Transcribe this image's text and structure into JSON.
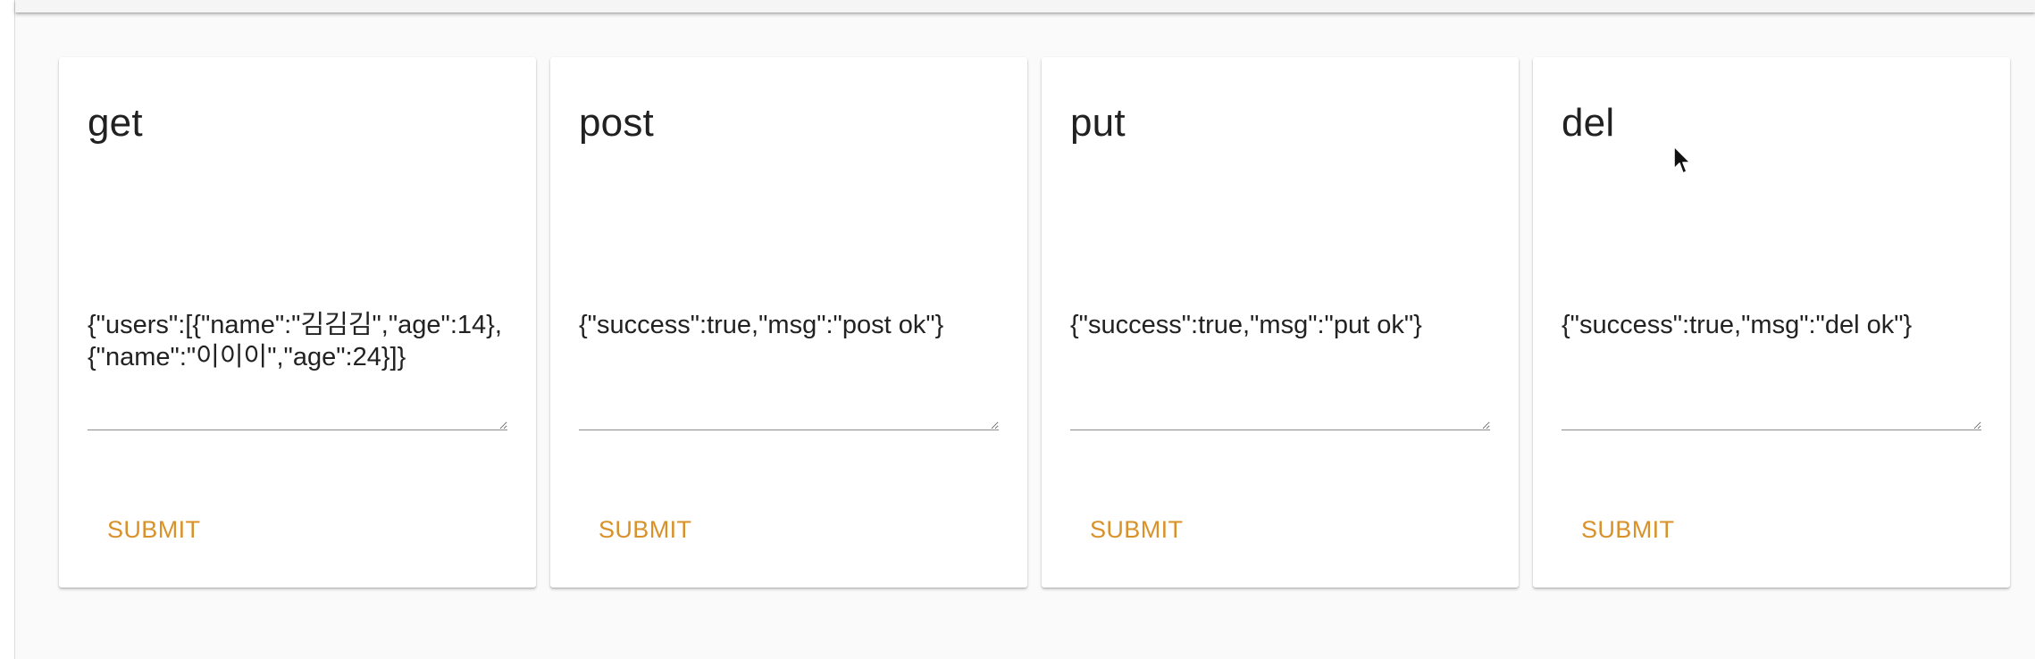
{
  "cards": [
    {
      "title": "get",
      "response": "{\"users\":[{\"name\":\"김김김\",\"age\":14},{\"name\":\"이이이\",\"age\":24}]}",
      "submit_label": "SUBMIT"
    },
    {
      "title": "post",
      "response": "{\"success\":true,\"msg\":\"post ok\"}",
      "submit_label": "SUBMIT"
    },
    {
      "title": "put",
      "response": "{\"success\":true,\"msg\":\"put ok\"}",
      "submit_label": "SUBMIT"
    },
    {
      "title": "del",
      "response": "{\"success\":true,\"msg\":\"del ok\"}",
      "submit_label": "SUBMIT"
    }
  ],
  "colors": {
    "accent": "#d9912a",
    "background": "#fafafa",
    "card": "#ffffff",
    "text": "#212121"
  },
  "icons": {
    "cursor": "mouse-pointer-icon"
  }
}
